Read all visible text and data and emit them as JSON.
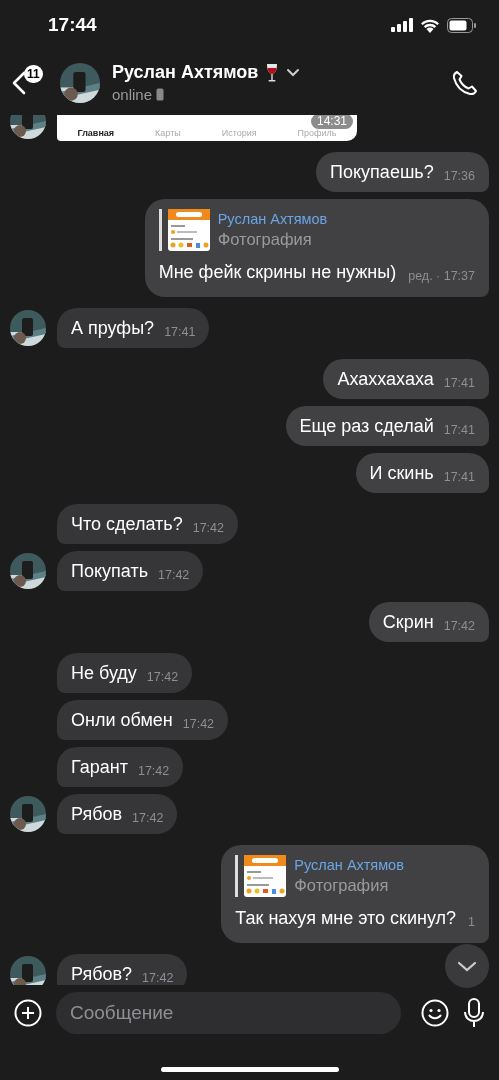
{
  "status_bar": {
    "time": "17:44"
  },
  "header": {
    "back_badge": "11",
    "name": "Руслан Ахтямов",
    "status": "online"
  },
  "messages": [
    {
      "kind": "screenshot",
      "outgoing": false,
      "avatar": true,
      "tabs": [
        {
          "label": "Главная",
          "selected": true
        },
        {
          "label": "Карты",
          "selected": false
        },
        {
          "label": "История",
          "selected": false
        },
        {
          "label": "Профиль",
          "selected": false
        }
      ],
      "time": "14:31"
    },
    {
      "kind": "text",
      "outgoing": true,
      "avatar": false,
      "text": "Покупаешь?",
      "time": "17:36"
    },
    {
      "kind": "reply",
      "outgoing": true,
      "avatar": false,
      "reply_name": "Руслан Ахтямов",
      "reply_type": "Фотография",
      "text": "Мне фейк скрины не нужны)",
      "time": "ред. · 17:37"
    },
    {
      "kind": "text",
      "outgoing": false,
      "avatar": true,
      "text": "А пруфы?",
      "time": "17:41"
    },
    {
      "kind": "text",
      "outgoing": true,
      "avatar": false,
      "text": "Ахаххахаха",
      "time": "17:41"
    },
    {
      "kind": "text",
      "outgoing": true,
      "avatar": false,
      "text": "Еще раз сделай",
      "time": "17:41"
    },
    {
      "kind": "text",
      "outgoing": true,
      "avatar": false,
      "text": "И скинь",
      "time": "17:41"
    },
    {
      "kind": "text",
      "outgoing": false,
      "avatar": false,
      "text": "Что сделать?",
      "time": "17:42"
    },
    {
      "kind": "text",
      "outgoing": false,
      "avatar": true,
      "text": "Покупать",
      "time": "17:42"
    },
    {
      "kind": "text",
      "outgoing": true,
      "avatar": false,
      "text": "Скрин",
      "time": "17:42"
    },
    {
      "kind": "text",
      "outgoing": false,
      "avatar": false,
      "text": "Не буду",
      "time": "17:42"
    },
    {
      "kind": "text",
      "outgoing": false,
      "avatar": false,
      "text": "Онли обмен",
      "time": "17:42"
    },
    {
      "kind": "text",
      "outgoing": false,
      "avatar": false,
      "text": "Гарант",
      "time": "17:42"
    },
    {
      "kind": "text",
      "outgoing": false,
      "avatar": true,
      "text": "Рябов",
      "time": "17:42"
    },
    {
      "kind": "reply",
      "outgoing": true,
      "avatar": false,
      "reply_name": "Руслан Ахтямов",
      "reply_type": "Фотография",
      "text": "Так нахуя мне это скинул?",
      "time": "1"
    },
    {
      "kind": "text",
      "outgoing": false,
      "avatar": true,
      "text": "Рябов?",
      "time": "17:42"
    }
  ],
  "composer": {
    "placeholder": "Сообщение"
  }
}
